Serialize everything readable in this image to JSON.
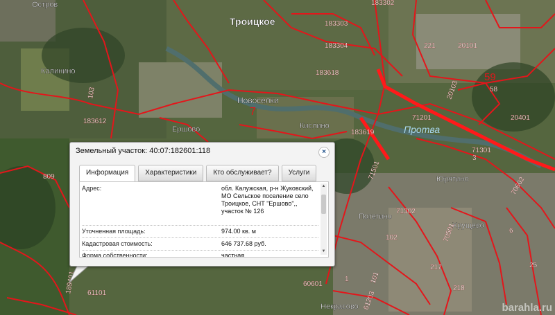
{
  "map": {
    "places": {
      "ostrov": "Остров",
      "troitskoe": "Троицкое",
      "kalinino": "Калинино",
      "novoselki": "Новоселки",
      "novoselki_num": "7",
      "ershovo": "Ершово",
      "kislino": "Кислино",
      "yuryatino": "Юрятино",
      "potetino": "Потетино",
      "khrushchevo": "Хрущево",
      "nekrasovo": "Некрасово",
      "river": "Протва"
    },
    "parcels": {
      "p183302": "183302",
      "p183303": "183303",
      "p183304": "183304",
      "p183618": "183618",
      "p183612": "183612",
      "p183619": "183619",
      "p221": "221",
      "p20101": "20101",
      "p59": "59",
      "p58": "58",
      "p20103": "20103",
      "p71201": "71201",
      "p71301": "71301",
      "p3": "3",
      "p20401": "20401",
      "p71501": "71501",
      "p71302": "71302",
      "p70602": "70602",
      "p70501": "70501",
      "p102": "102",
      "p217": "217",
      "p218": "218",
      "p25": "25",
      "p6": "6",
      "p1": "1",
      "p101": "101",
      "p60601": "60601",
      "p61203": "61203",
      "p61101": "61101",
      "p809": "809",
      "p103": "103",
      "p189401": "189401"
    }
  },
  "popup": {
    "title": "Земельный участок: 40:07:182601:118",
    "close": "×",
    "tabs": [
      "Информация",
      "Характеристики",
      "Кто обслуживает?",
      "Услуги"
    ],
    "rows": [
      {
        "label": "Адрес:",
        "value": "обл. Калужская, р-н Жуковский, МО Сельское поселение село Троицкое, СНТ \"Ершово\",, участок № 126"
      },
      {
        "label": "Уточненная площадь:",
        "value": "974.00 кв. м"
      },
      {
        "label": "Кадастровая стоимость:",
        "value": "646 737.68 руб."
      },
      {
        "label": "Форма собственности:",
        "value": "частная"
      }
    ]
  },
  "watermark": "barahla.ru"
}
